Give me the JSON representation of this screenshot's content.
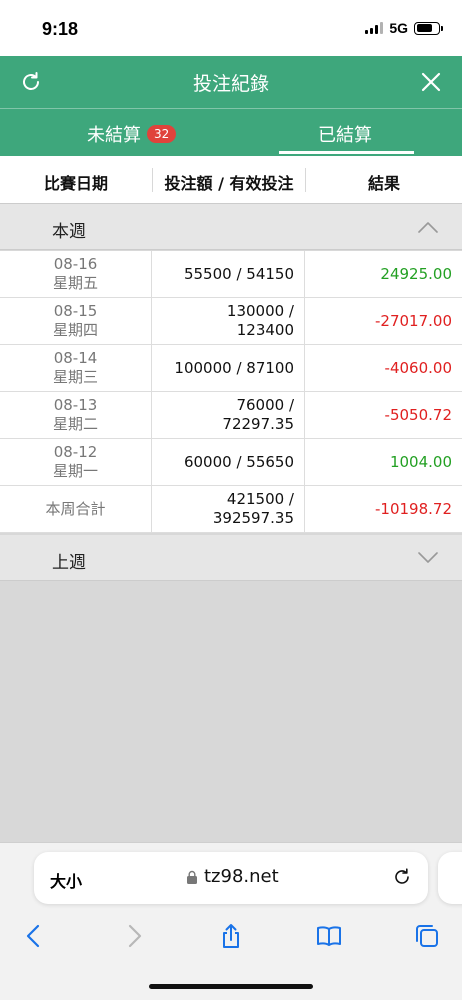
{
  "status": {
    "time": "9:18",
    "network": "5G"
  },
  "header": {
    "title": "投注紀錄"
  },
  "tabs": {
    "unsettled": {
      "label": "未結算",
      "badge": "32"
    },
    "settled": {
      "label": "已結算"
    }
  },
  "columns": {
    "date": "比賽日期",
    "amount": "投注額 / 有效投注",
    "result": "結果"
  },
  "this_week": {
    "title": "本週",
    "rows": [
      {
        "date": "08-16",
        "weekday": "星期五",
        "amount_line1": "55500 / 54150",
        "amount_line2": "",
        "result": "24925.00"
      },
      {
        "date": "08-15",
        "weekday": "星期四",
        "amount_line1": "130000 /",
        "amount_line2": "123400",
        "result": "-27017.00"
      },
      {
        "date": "08-14",
        "weekday": "星期三",
        "amount_line1": "100000 / 87100",
        "amount_line2": "",
        "result": "-4060.00"
      },
      {
        "date": "08-13",
        "weekday": "星期二",
        "amount_line1": "76000 /",
        "amount_line2": "72297.35",
        "result": "-5050.72"
      },
      {
        "date": "08-12",
        "weekday": "星期一",
        "amount_line1": "60000 / 55650",
        "amount_line2": "",
        "result": "1004.00"
      }
    ],
    "total": {
      "label": "本周合計",
      "amount_line1": "421500 /",
      "amount_line2": "392597.35",
      "result": "-10198.72"
    }
  },
  "last_week": {
    "title": "上週"
  },
  "browser": {
    "text_size_label": "大小",
    "url": "tz98.net"
  },
  "colors": {
    "brand_green": "#3ea77c",
    "positive": "#23a023",
    "negative": "#e02020",
    "badge": "#e0433b"
  }
}
